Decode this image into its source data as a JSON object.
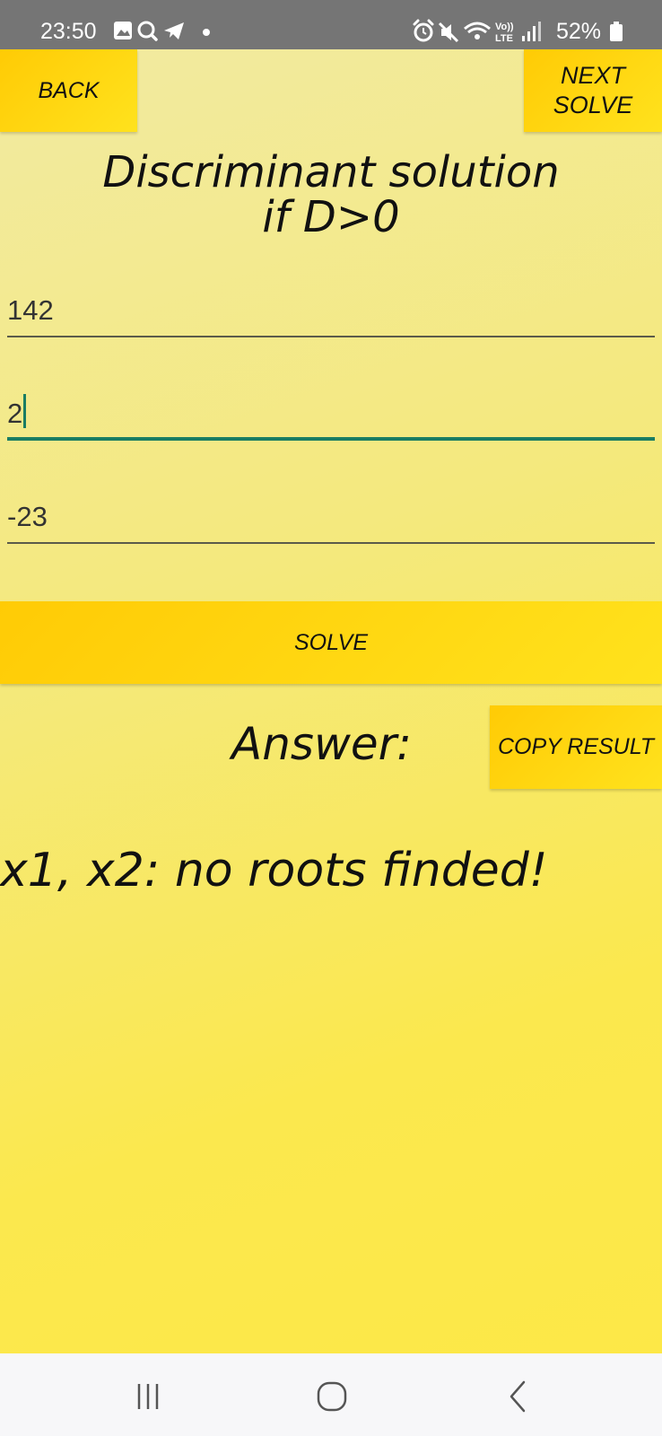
{
  "status_bar": {
    "time": "23:50",
    "battery": "52%",
    "left_icons": [
      "image-icon",
      "search-icon",
      "telegram-icon",
      "dot-icon"
    ],
    "right_icons": [
      "alarm-icon",
      "mute-icon",
      "wifi-icon",
      "volte-icon",
      "signal-icon",
      "battery-icon"
    ]
  },
  "header": {
    "back_label": "BACK",
    "next_label_line1": "NEXT",
    "next_label_line2": "SOLVE"
  },
  "title": {
    "line1": "Discriminant solution",
    "line2": "if D>0"
  },
  "inputs": [
    {
      "value": "142",
      "focused": false
    },
    {
      "value": "2",
      "focused": true
    },
    {
      "value": "-23",
      "focused": false
    }
  ],
  "solve_label": "SOLVE",
  "answer": {
    "label": "Answer:",
    "copy_label": "COPY RESULT",
    "result": "x1, x2: no roots finded!"
  },
  "nav_bar": {
    "icons": [
      "recent-apps-icon",
      "home-icon",
      "back-icon"
    ]
  },
  "colors": {
    "status_bar_bg": "#757575",
    "button_yellow": "#ffd60a",
    "focus_accent": "#1a7d63",
    "background_top": "#f2eaa1",
    "background_bottom": "#fde847"
  }
}
